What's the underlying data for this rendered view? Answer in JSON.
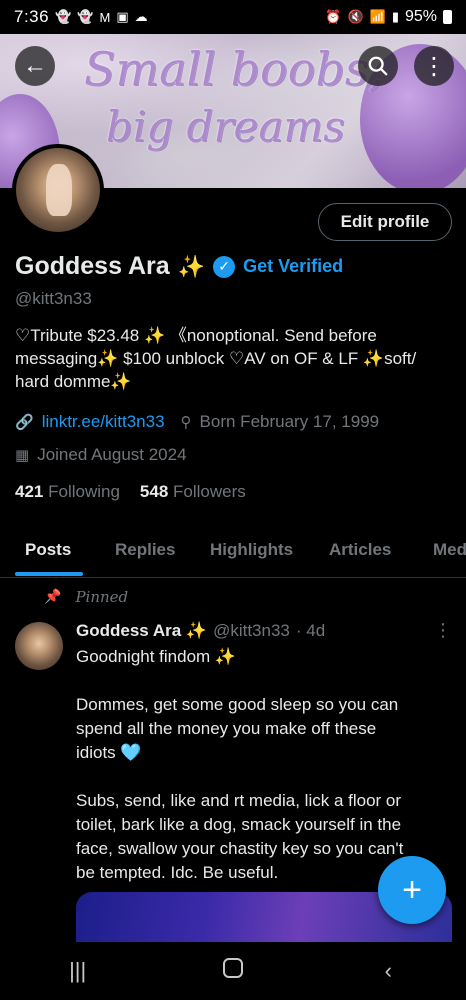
{
  "status_bar": {
    "time": "7:36",
    "left_icons": [
      "snapchat-icon",
      "snapchat-icon",
      "gmail-icon",
      "gallery-icon",
      "cloud-icon"
    ],
    "right_icons": [
      "alarm-icon",
      "mute-icon",
      "wifi-icon",
      "signal-icon"
    ],
    "battery": "95%"
  },
  "banner": {
    "line1": "Small boobs,",
    "line2": "big dreams"
  },
  "profile": {
    "edit_label": "Edit profile",
    "display_name": "Goddess Ara",
    "name_emoji": "✨",
    "get_verified": "Get Verified",
    "handle": "@kitt3n33",
    "bio_line1": "♡Tribute $23.48 ✨ 《nonoptional. Send before",
    "bio_line2": "messaging✨ $100  unblock ♡AV on OF & LF ✨soft/",
    "bio_line3": "hard domme✨",
    "link": "linktr.ee/kitt3n33",
    "born": "Born February 17, 1999",
    "joined": "Joined August 2024",
    "following_count": "421",
    "following_label": "Following",
    "followers_count": "548",
    "followers_label": "Followers"
  },
  "tabs": [
    {
      "label": "Posts",
      "active": true
    },
    {
      "label": "Replies",
      "active": false
    },
    {
      "label": "Highlights",
      "active": false
    },
    {
      "label": "Articles",
      "active": false
    },
    {
      "label": "Med",
      "active": false
    }
  ],
  "pinned_post": {
    "pinned_label": "Pinned",
    "author": "Goddess Ara ✨",
    "handle": "@kitt3n33",
    "age": "· 4d",
    "line1": "Goodnight findom ✨",
    "para2_line1": "Dommes, get some good sleep so you can",
    "para2_line2": "spend all the money you make off these",
    "para2_line3": "idiots 🩵",
    "para3_line1": "Subs, send, like and rt media, lick a floor or",
    "para3_line2": "toilet, bark like a dog, smack yourself in the",
    "para3_line3": "face, swallow your chastity key so you can't",
    "para3_line4": "be tempted. Idc. Be useful."
  },
  "colors": {
    "accent": "#1d9bf0",
    "muted": "#71767b",
    "text": "#e7e9ea",
    "background": "#000000"
  }
}
